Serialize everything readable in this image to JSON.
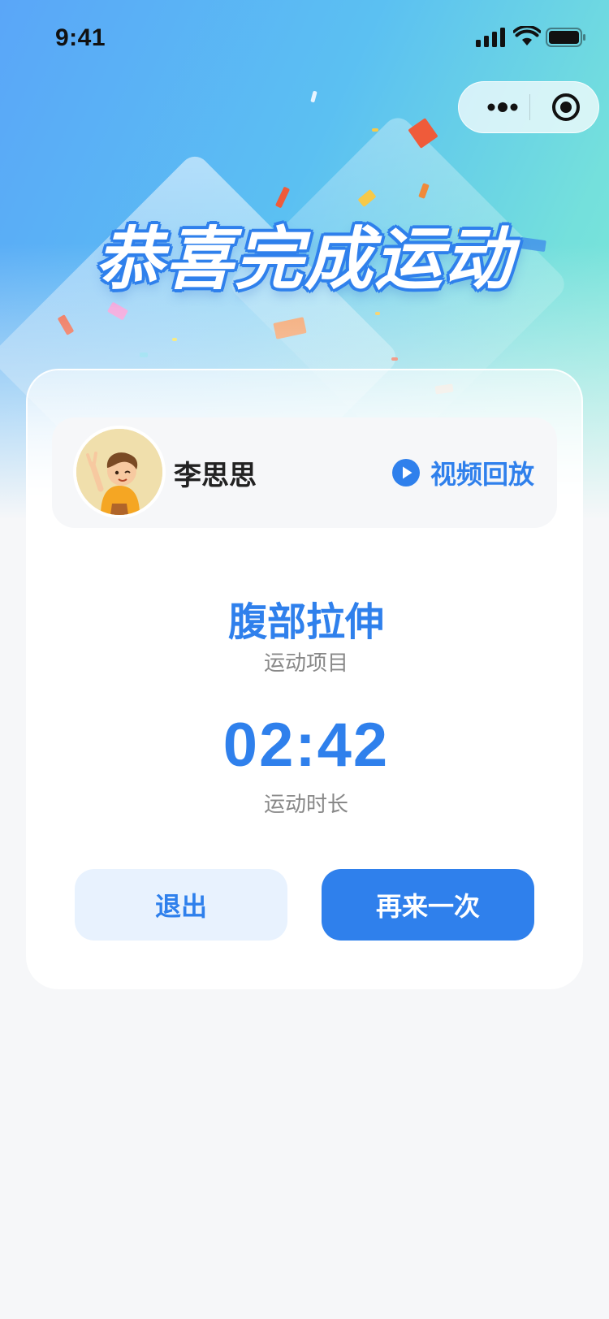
{
  "status_bar": {
    "time": "9:41",
    "signal_icon": "signal-icon",
    "wifi_icon": "wifi-icon",
    "battery_icon": "battery-icon"
  },
  "capsule": {
    "more_icon": "more-dots-icon",
    "close_icon": "target-close-icon"
  },
  "hero": {
    "title": "恭喜完成运动"
  },
  "user": {
    "name": "李思思",
    "avatar_icon": "avatar-boy-icon"
  },
  "replay": {
    "icon": "play-circle-icon",
    "label": "视频回放"
  },
  "exercise": {
    "name": "腹部拉伸",
    "caption": "运动项目"
  },
  "duration": {
    "value": "02:42",
    "caption": "运动时长"
  },
  "buttons": {
    "exit_label": "退出",
    "again_label": "再来一次"
  },
  "colors": {
    "primary": "#2f80ec",
    "primary_light": "#e8f2fe",
    "page_bg": "#f6f7f9",
    "caption": "#888888"
  }
}
